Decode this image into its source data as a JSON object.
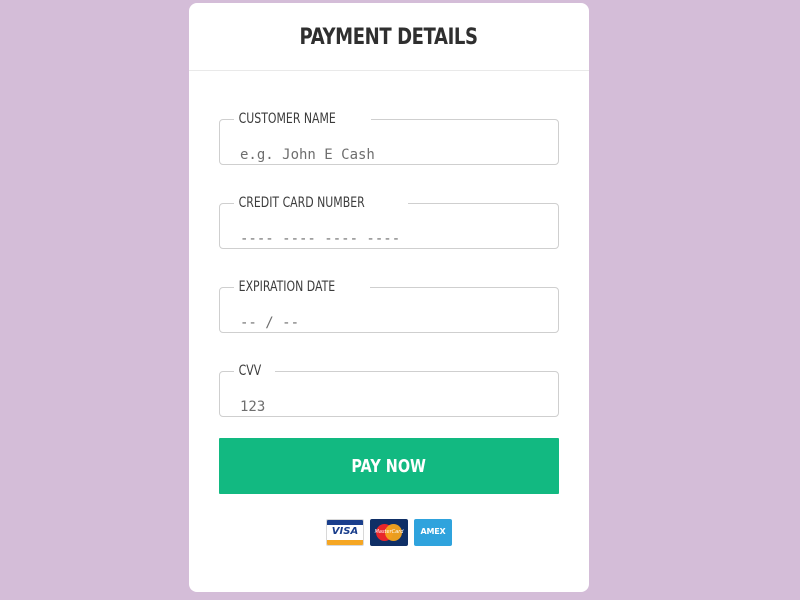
{
  "page": {
    "title": "PAYMENT DETAILS"
  },
  "form": {
    "customer_name": {
      "label": "CUSTOMER NAME",
      "placeholder": "e.g. John E Cash"
    },
    "card_number": {
      "label": "CREDIT CARD NUMBER",
      "placeholder": "---- ---- ---- ----"
    },
    "expiration": {
      "label": "EXPIRATION DATE",
      "placeholder": "-- / --"
    },
    "cvv": {
      "label": "CVV",
      "placeholder": "123"
    }
  },
  "pay_button": {
    "label": "PAY NOW",
    "color": "#12b981"
  },
  "card_logos": [
    {
      "name": "visa-icon",
      "text": "VISA"
    },
    {
      "name": "mastercard-icon",
      "text": "MasterCard"
    },
    {
      "name": "amex-icon",
      "text": "AMEX"
    }
  ],
  "colors": {
    "background": "#d4bdd8",
    "card": "#ffffff"
  }
}
